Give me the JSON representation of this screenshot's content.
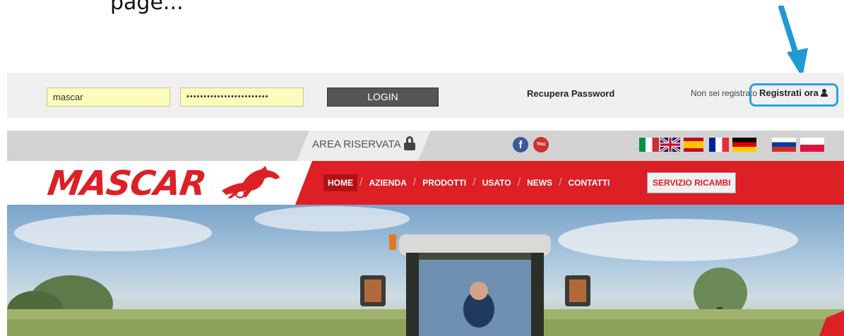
{
  "caption": {
    "text": "page..."
  },
  "login_bar": {
    "username_value": "mascar",
    "password_value": "••••••••••••••••••••••••",
    "login_label": "LOGIN",
    "recover_label": "Recupera Password",
    "register_prompt": "Non sei registrato",
    "register_label": "Registrati ora"
  },
  "social_bar": {
    "area_label": "AREA RISERVATA",
    "facebook_glyph": "f",
    "youtube_glyph": "You",
    "languages": [
      "it",
      "en",
      "es",
      "fr",
      "de",
      "ru",
      "pl"
    ]
  },
  "main_nav": {
    "logo": "MASCAR",
    "items": [
      {
        "label": "HOME",
        "active": true
      },
      {
        "label": "AZIENDA"
      },
      {
        "label": "PRODOTTI"
      },
      {
        "label": "USATO"
      },
      {
        "label": "NEWS"
      },
      {
        "label": "CONTATTI"
      }
    ],
    "servizio_label": "SERVIZIO RICAMBI"
  },
  "colors": {
    "brand_red": "#dd1f26",
    "highlight_blue": "#2aa3e0",
    "field_yellow": "#fcfcbc"
  },
  "icons": [
    "down-arrow-annotation",
    "user-icon",
    "lock-icon",
    "facebook-icon",
    "youtube-icon",
    "horse-logo-icon"
  ]
}
